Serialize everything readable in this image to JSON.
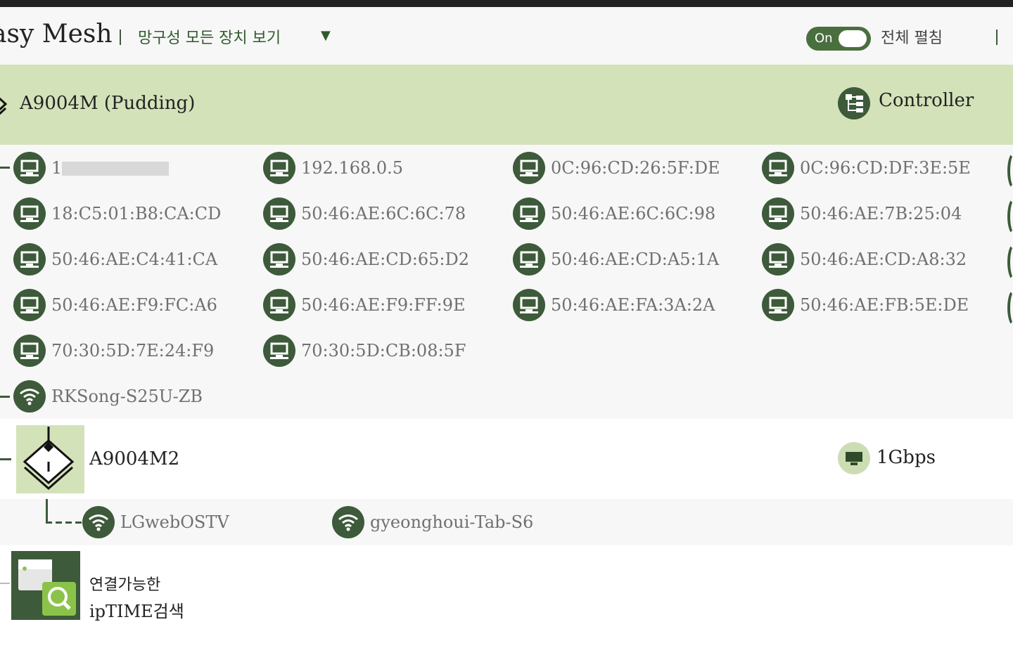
{
  "header": {
    "app_title": "asy Mesh",
    "filter_label": "망구성 모든 장치 보기",
    "filter_caret": "▼",
    "toggle_state": "On",
    "expand_all_label": "전체 펼침"
  },
  "controller": {
    "name": "A9004M (Pudding)",
    "role": "Controller"
  },
  "clients": [
    {
      "label": "1",
      "icon": "wired-pc-icon"
    },
    {
      "label": "192.168.0.5",
      "icon": "wired-pc-icon"
    },
    {
      "label": "0C:96:CD:26:5F:DE",
      "icon": "wired-pc-icon"
    },
    {
      "label": "0C:96:CD:DF:3E:5E",
      "icon": "wired-pc-icon"
    },
    {
      "label": "18:C5:01:B8:CA:CD",
      "icon": "wired-pc-icon"
    },
    {
      "label": "50:46:AE:6C:6C:78",
      "icon": "wired-pc-icon"
    },
    {
      "label": "50:46:AE:6C:6C:98",
      "icon": "wired-pc-icon"
    },
    {
      "label": "50:46:AE:7B:25:04",
      "icon": "wired-pc-icon"
    },
    {
      "label": "50:46:AE:C4:41:CA",
      "icon": "wired-pc-icon"
    },
    {
      "label": "50:46:AE:CD:65:D2",
      "icon": "wired-pc-icon"
    },
    {
      "label": "50:46:AE:CD:A5:1A",
      "icon": "wired-pc-icon"
    },
    {
      "label": "50:46:AE:CD:A8:32",
      "icon": "wired-pc-icon"
    },
    {
      "label": "50:46:AE:F9:FC:A6",
      "icon": "wired-pc-icon"
    },
    {
      "label": "50:46:AE:F9:FF:9E",
      "icon": "wired-pc-icon"
    },
    {
      "label": "50:46:AE:FA:3A:2A",
      "icon": "wired-pc-icon"
    },
    {
      "label": "50:46:AE:FB:5E:DE",
      "icon": "wired-pc-icon"
    },
    {
      "label": "70:30:5D:7E:24:F9",
      "icon": "wired-pc-icon"
    },
    {
      "label": "70:30:5D:CB:08:5F",
      "icon": "wired-pc-icon"
    },
    {
      "label": "RKSong-S25U-ZB",
      "icon": "wifi-icon"
    }
  ],
  "node2": {
    "name": "A9004M2",
    "link_speed": "1Gbps",
    "clients": [
      {
        "label": "LGwebOSTV",
        "icon": "wifi-icon"
      },
      {
        "label": "gyeonghoui-Tab-S6",
        "icon": "wifi-icon"
      }
    ]
  },
  "scan": {
    "line1": "연결가능한",
    "line2": "ipTIME검색"
  },
  "colors": {
    "accent_dark": "#3d5a3a",
    "controller_bg": "#d3e2b9",
    "panel_bg": "#f7f7f7"
  }
}
